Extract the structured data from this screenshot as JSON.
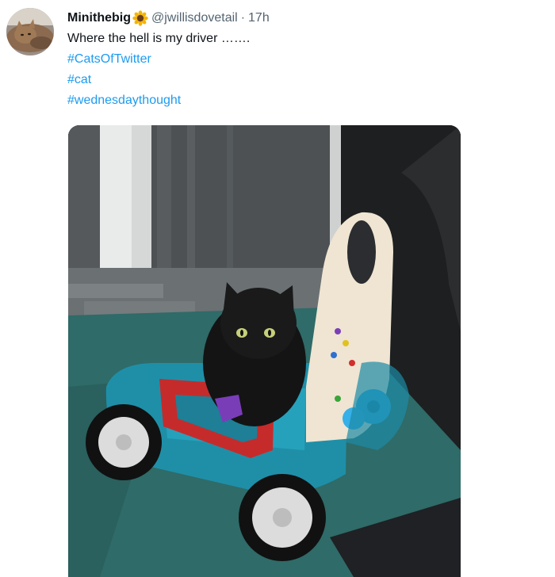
{
  "tweet": {
    "display_name": "Minithebig",
    "name_emoji": "sunflower-icon",
    "handle": "@jwillisdovetail",
    "separator": "·",
    "time": "17h",
    "text": "Where the hell is my driver …….",
    "hashtags": [
      "#CatsOfTwitter",
      "#cat",
      "#wednesdaythought"
    ]
  },
  "colors": {
    "link": "#1d9bf0",
    "secondary_text": "#536471",
    "primary_text": "#0f1419"
  }
}
